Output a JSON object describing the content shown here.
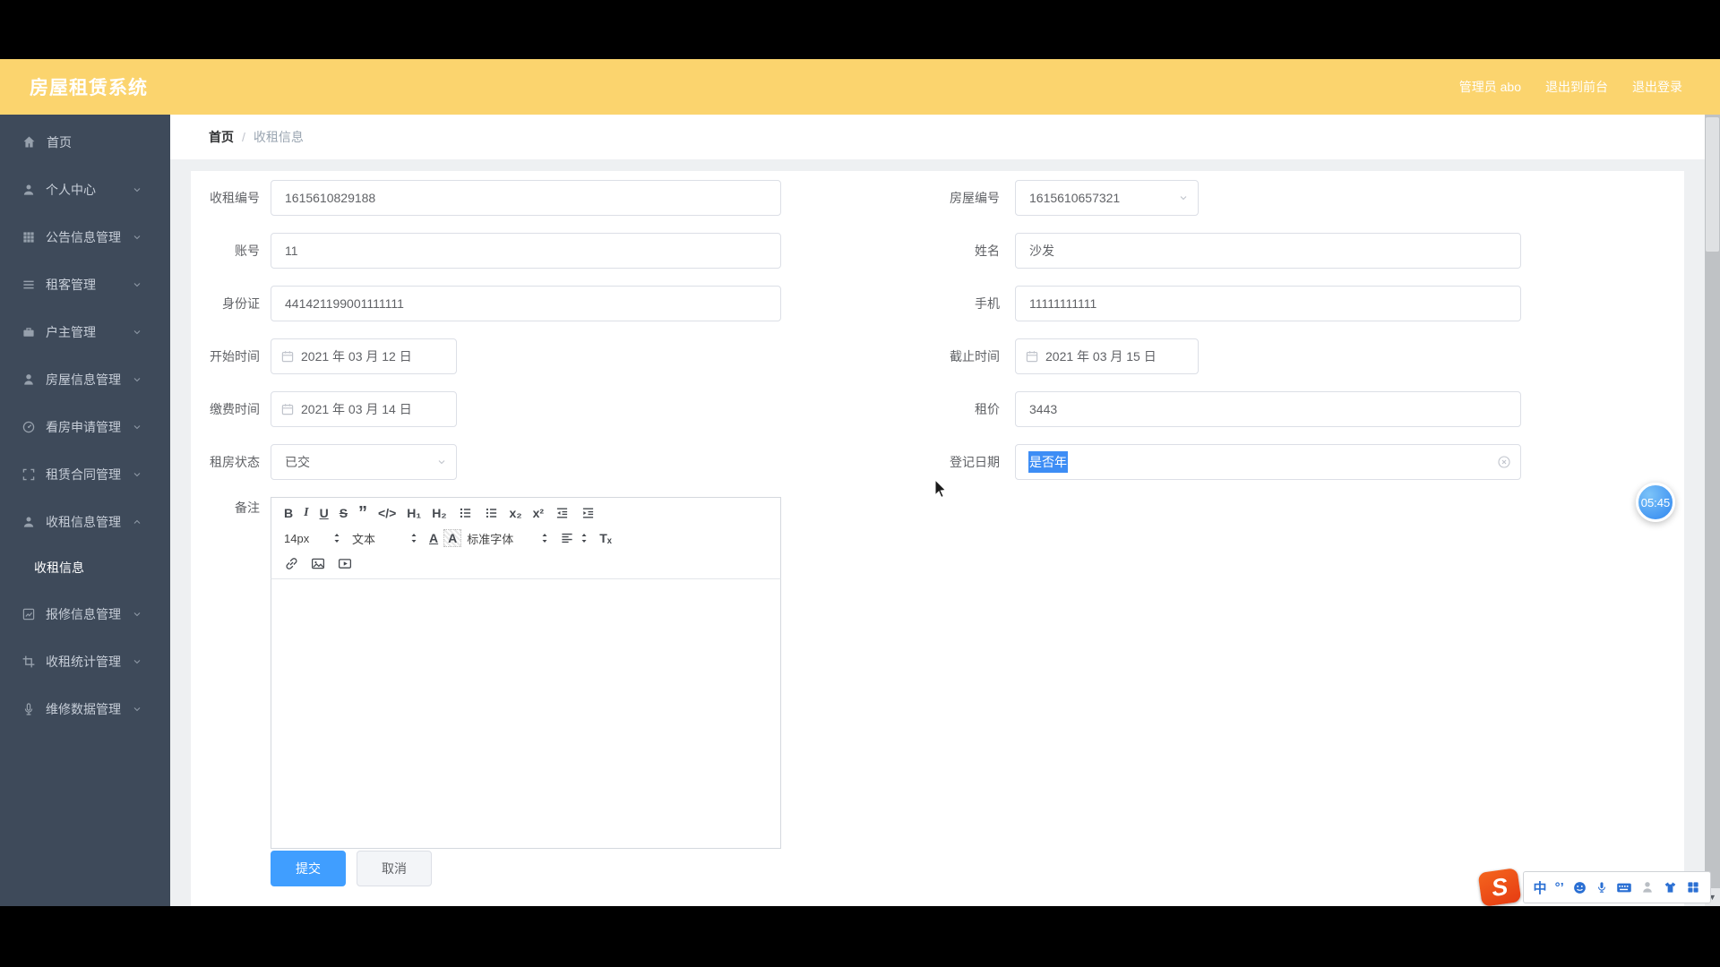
{
  "colors": {
    "header_bg": "#fbd46e",
    "sidebar_bg": "#3e4a5a",
    "primary": "#409eff",
    "selection": "#3d8df5",
    "ime_blue": "#2a6fd3"
  },
  "header": {
    "title": "房屋租赁系统",
    "links": [
      "管理员 abo",
      "退出到前台",
      "退出登录"
    ]
  },
  "sidebar": {
    "items": [
      {
        "icon": "home",
        "label": "首页",
        "chevron": null
      },
      {
        "icon": "user",
        "label": "个人中心",
        "chevron": "down"
      },
      {
        "icon": "grid",
        "label": "公告信息管理",
        "chevron": "down"
      },
      {
        "icon": "list",
        "label": "租客管理",
        "chevron": "down"
      },
      {
        "icon": "briefcase",
        "label": "户主管理",
        "chevron": "down"
      },
      {
        "icon": "person",
        "label": "房屋信息管理",
        "chevron": "down"
      },
      {
        "icon": "gauge",
        "label": "看房申请管理",
        "chevron": "down"
      },
      {
        "icon": "frame",
        "label": "租赁合同管理",
        "chevron": "down"
      },
      {
        "icon": "user",
        "label": "收租信息管理",
        "chevron": "up",
        "children": [
          {
            "label": "收租信息",
            "active": true
          }
        ]
      },
      {
        "icon": "chart",
        "label": "报修信息管理",
        "chevron": "down"
      },
      {
        "icon": "crop",
        "label": "收租统计管理",
        "chevron": "down"
      },
      {
        "icon": "mic",
        "label": "维修数据管理",
        "chevron": "down"
      }
    ]
  },
  "breadcrumb": {
    "items": [
      "首页",
      "收租信息"
    ],
    "separator": "/"
  },
  "form": {
    "rows": [
      {
        "left": {
          "name": "rent-id",
          "label": "收租编号",
          "type": "input",
          "value": "1615610829188",
          "width": "wide"
        },
        "right": {
          "name": "house-id",
          "label": "房屋编号",
          "type": "select",
          "value": "1615610657321",
          "width": "narrow"
        }
      },
      {
        "left": {
          "name": "account",
          "label": "账号",
          "type": "input",
          "value": "11",
          "width": "wide"
        },
        "right": {
          "name": "tenant-name",
          "label": "姓名",
          "type": "input",
          "value": "沙发",
          "width": "wide"
        }
      },
      {
        "left": {
          "name": "id-card",
          "label": "身份证",
          "type": "input",
          "value": "441421199001111111",
          "width": "wide"
        },
        "right": {
          "name": "phone",
          "label": "手机",
          "type": "input",
          "value": "11111111111",
          "width": "wide"
        }
      },
      {
        "left": {
          "name": "start-time",
          "label": "开始时间",
          "type": "date",
          "value": "2021 年 03 月 12 日",
          "width": "narrow"
        },
        "right": {
          "name": "end-time",
          "label": "截止时间",
          "type": "date",
          "value": "2021 年 03 月 15 日",
          "width": "narrow"
        }
      },
      {
        "left": {
          "name": "pay-time",
          "label": "缴费时间",
          "type": "date",
          "value": "2021 年 03 月 14 日",
          "width": "narrow"
        },
        "right": {
          "name": "rent-price",
          "label": "租价",
          "type": "input",
          "value": "3443",
          "width": "wide"
        }
      },
      {
        "left": {
          "name": "rent-status",
          "label": "租房状态",
          "type": "select",
          "value": "已交",
          "width": "narrow"
        },
        "right": {
          "name": "register-date",
          "label": "登记日期",
          "type": "input-selected",
          "value": "是否年",
          "width": "wide",
          "clearable": true
        }
      }
    ],
    "remark_label": "备注"
  },
  "editor": {
    "toolbar_rows": [
      [
        {
          "name": "bold",
          "glyph": "B"
        },
        {
          "name": "italic",
          "glyph": "I"
        },
        {
          "name": "underline",
          "glyph": "U"
        },
        {
          "name": "strike",
          "glyph": "S"
        },
        {
          "name": "blockquote",
          "glyph": "”"
        },
        {
          "name": "code",
          "glyph": "</>"
        },
        {
          "name": "header-1",
          "glyph": "H₁"
        },
        {
          "name": "header-2",
          "glyph": "H₂"
        },
        {
          "name": "list-ordered",
          "iconName": "ol"
        },
        {
          "name": "list-bullet",
          "iconName": "ul"
        },
        {
          "name": "subscript",
          "glyph": "x₂"
        },
        {
          "name": "superscript",
          "glyph": "x²"
        },
        {
          "name": "outdent",
          "iconName": "outdent"
        },
        {
          "name": "indent",
          "iconName": "indent"
        }
      ],
      [
        {
          "name": "size",
          "glyph": "14px",
          "dropdown": true
        },
        {
          "name": "style",
          "glyph": "文本",
          "dropdown": true
        },
        {
          "name": "color",
          "glyph": "A",
          "cls": "q-color"
        },
        {
          "name": "background",
          "glyph": "A",
          "cls": "q-bg"
        },
        {
          "name": "font",
          "glyph": "标准字体",
          "dropdown": true
        },
        {
          "name": "align",
          "iconName": "align",
          "dropdown": true
        },
        {
          "name": "clean",
          "glyph": "Tₓ"
        }
      ],
      [
        {
          "name": "link",
          "iconName": "link"
        },
        {
          "name": "image",
          "iconName": "image"
        },
        {
          "name": "video",
          "iconName": "video"
        }
      ]
    ]
  },
  "buttons": {
    "submit": "提交",
    "cancel": "取消"
  },
  "overlay": {
    "timer": "05:45",
    "ime_mode": "中",
    "ime_punct": "°’",
    "ime_logo": "S"
  }
}
